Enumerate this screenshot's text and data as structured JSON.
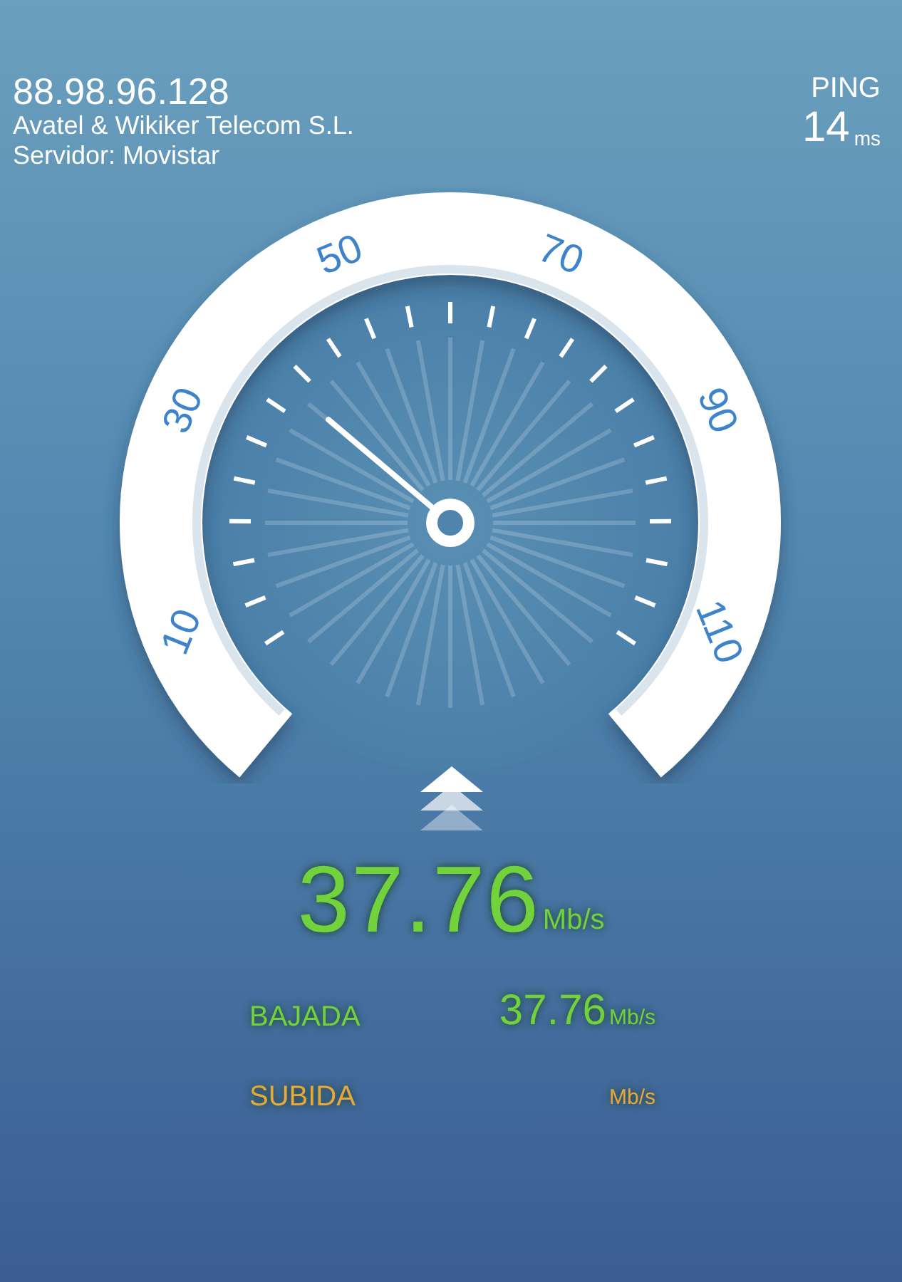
{
  "connection": {
    "ip": "88.98.96.128",
    "provider": "Avatel & Wikiker Telecom S.L.",
    "server": "Servidor: Movistar"
  },
  "ping": {
    "label": "PING",
    "value": "14",
    "unit": "ms"
  },
  "gauge": {
    "scale_labels": [
      "10",
      "30",
      "50",
      "70",
      "90",
      "110"
    ]
  },
  "speed": {
    "value": "37.76",
    "unit": "Mb/s"
  },
  "results": [
    {
      "kind": "download",
      "label": "BAJADA",
      "value": "37.76",
      "unit": "Mb/s"
    },
    {
      "kind": "upload",
      "label": "SUBIDA",
      "unit": "Mb/s"
    }
  ]
}
